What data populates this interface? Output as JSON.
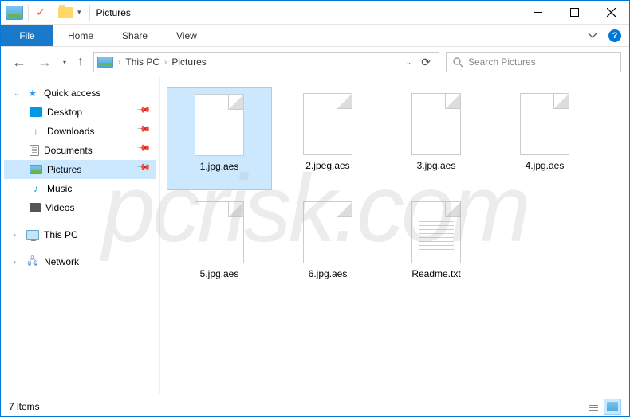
{
  "window": {
    "title": "Pictures"
  },
  "ribbon": {
    "file": "File",
    "tabs": [
      "Home",
      "Share",
      "View"
    ]
  },
  "address": {
    "segments": [
      "This PC",
      "Pictures"
    ]
  },
  "search": {
    "placeholder": "Search Pictures"
  },
  "nav": {
    "quick_access": "Quick access",
    "items": [
      {
        "label": "Desktop",
        "pinned": true
      },
      {
        "label": "Downloads",
        "pinned": true
      },
      {
        "label": "Documents",
        "pinned": true
      },
      {
        "label": "Pictures",
        "pinned": true,
        "selected": true
      },
      {
        "label": "Music",
        "pinned": false
      },
      {
        "label": "Videos",
        "pinned": false
      }
    ],
    "this_pc": "This PC",
    "network": "Network"
  },
  "files": [
    {
      "name": "1.jpg.aes",
      "type": "blank",
      "selected": true
    },
    {
      "name": "2.jpeg.aes",
      "type": "blank"
    },
    {
      "name": "3.jpg.aes",
      "type": "blank"
    },
    {
      "name": "4.jpg.aes",
      "type": "blank"
    },
    {
      "name": "5.jpg.aes",
      "type": "blank"
    },
    {
      "name": "6.jpg.aes",
      "type": "blank"
    },
    {
      "name": "Readme.txt",
      "type": "txt"
    }
  ],
  "status": {
    "count": "7 items"
  }
}
